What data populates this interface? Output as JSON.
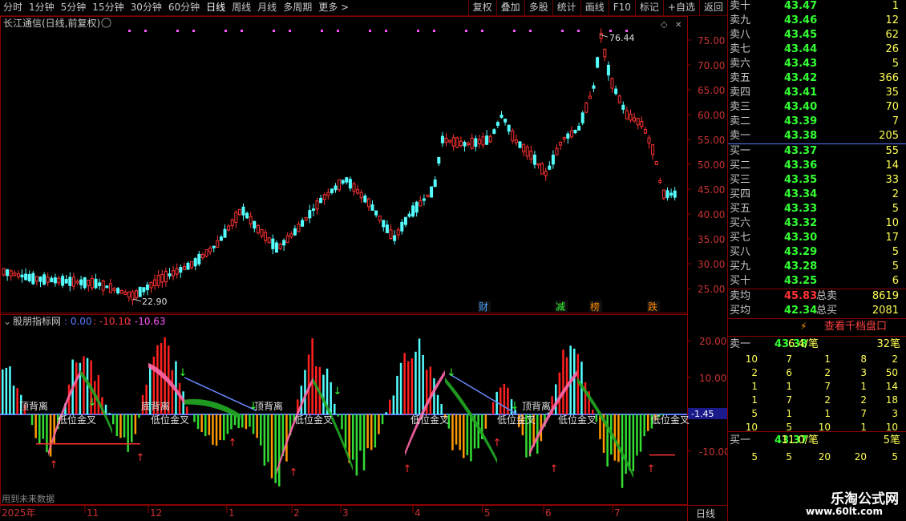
{
  "toolbar": {
    "periods": [
      "分时",
      "1分钟",
      "5分钟",
      "15分钟",
      "30分钟",
      "60分钟",
      "日线",
      "周线",
      "月线",
      "多周期",
      "更多 >"
    ],
    "active_period": "日线",
    "right_buttons": [
      "复权",
      "叠加",
      "多股",
      "统计",
      "画线",
      "F10",
      "标记",
      "+自选",
      "返回"
    ]
  },
  "chart": {
    "title": "长江通信(日线,前复权)",
    "high_label": "76.44",
    "low_label": "22.90",
    "y_ticks": [
      "75.00",
      "70.00",
      "65.00",
      "60.00",
      "55.00",
      "50.00",
      "45.00",
      "40.00",
      "35.00",
      "30.00",
      "25.00"
    ],
    "event_tags": [
      "财",
      "减",
      "榜",
      "跌"
    ],
    "months": [
      "2025年",
      "11",
      "12",
      "1",
      "2",
      "3",
      "4",
      "5",
      "6",
      "7"
    ],
    "period_label": "日线"
  },
  "indicator": {
    "name": "股朋指标网",
    "values": [
      ": 0.00",
      ": -10.10",
      ": -10.63"
    ],
    "y_ticks": [
      "20.00",
      "10.00",
      "-10.00"
    ],
    "current_value": "-1.45",
    "labels_top": [
      "顶背离",
      "底背离",
      "顶背离",
      "顶背离"
    ],
    "labels_gold": [
      "低位金叉",
      "低位金叉",
      "低位金叉",
      "低位金叉",
      "低位金叉",
      "低位金叉",
      "低位金叉",
      "低位金叉"
    ],
    "footer_note": "用到未来数据"
  },
  "orderbook": {
    "asks": [
      {
        "label": "卖十",
        "price": "43.47",
        "vol": "1"
      },
      {
        "label": "卖九",
        "price": "43.46",
        "vol": "12"
      },
      {
        "label": "卖八",
        "price": "43.45",
        "vol": "62"
      },
      {
        "label": "卖七",
        "price": "43.44",
        "vol": "26"
      },
      {
        "label": "卖六",
        "price": "43.43",
        "vol": "5"
      },
      {
        "label": "卖五",
        "price": "43.42",
        "vol": "366"
      },
      {
        "label": "卖四",
        "price": "43.41",
        "vol": "35"
      },
      {
        "label": "卖三",
        "price": "43.40",
        "vol": "70"
      },
      {
        "label": "卖二",
        "price": "43.39",
        "vol": "7"
      },
      {
        "label": "卖一",
        "price": "43.38",
        "vol": "205"
      }
    ],
    "bids": [
      {
        "label": "买一",
        "price": "43.37",
        "vol": "55"
      },
      {
        "label": "买二",
        "price": "43.36",
        "vol": "14"
      },
      {
        "label": "买三",
        "price": "43.35",
        "vol": "33"
      },
      {
        "label": "买四",
        "price": "43.34",
        "vol": "2"
      },
      {
        "label": "买五",
        "price": "43.33",
        "vol": "5"
      },
      {
        "label": "买六",
        "price": "43.32",
        "vol": "10"
      },
      {
        "label": "买七",
        "price": "43.30",
        "vol": "17"
      },
      {
        "label": "买八",
        "price": "43.29",
        "vol": "5"
      },
      {
        "label": "买九",
        "price": "43.28",
        "vol": "5"
      },
      {
        "label": "买十",
        "price": "43.25",
        "vol": "6"
      }
    ],
    "sell_avg": {
      "label": "卖均",
      "price": "45.83",
      "total_label": "总卖",
      "total": "8619"
    },
    "buy_avg": {
      "label": "买均",
      "price": "42.34",
      "total_label": "总买",
      "total": "2081"
    },
    "ten_level_button": "查看千档盘口",
    "ask1_detail": {
      "label": "卖一",
      "price": "43.38",
      "per": "6.4/笔",
      "count": "32笔"
    },
    "ask1_queue": [
      [
        "10",
        "7",
        "1",
        "8",
        "2"
      ],
      [
        "2",
        "6",
        "2",
        "3",
        "50"
      ],
      [
        "1",
        "1",
        "7",
        "1",
        "14"
      ],
      [
        "1",
        "7",
        "2",
        "2",
        "18"
      ],
      [
        "5",
        "1",
        "1",
        "7",
        "3"
      ],
      [
        "10",
        "5",
        "10",
        "1",
        "10"
      ]
    ],
    "bid1_detail": {
      "label": "买一",
      "price": "43.37",
      "per": "11.0/笔",
      "count": "5笔"
    },
    "bid1_queue": [
      [
        "5",
        "5",
        "20",
        "20",
        "5"
      ]
    ]
  },
  "brand": {
    "name": "乐淘公式网",
    "url": "www.60lt.com"
  },
  "colors": {
    "up": "#ff3232",
    "down": "#54ffff",
    "ask_price": "#33ff33",
    "volume": "#ffff55",
    "grid": "#8b0000",
    "magenta": "#ff55ff"
  }
}
